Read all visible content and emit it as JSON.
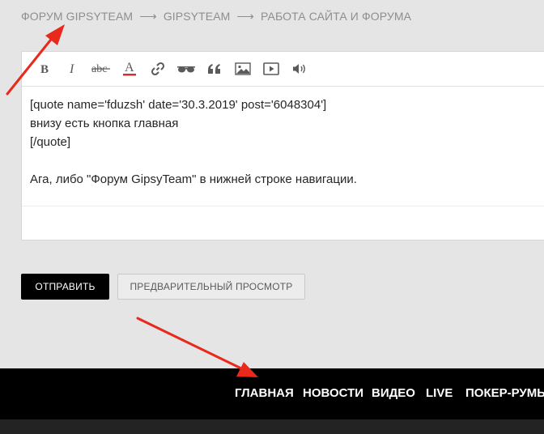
{
  "breadcrumb": {
    "items": [
      "ФОРУМ GIPSYTEAM",
      "GIPSYTEAM",
      "РАБОТА САЙТА И ФОРУМА"
    ],
    "separator": "⟶"
  },
  "toolbar": {
    "buttons": [
      "bold-icon",
      "italic-icon",
      "strikethrough-icon",
      "text-color-icon",
      "link-icon",
      "glasses-icon",
      "quote-icon",
      "image-icon",
      "video-icon",
      "audio-icon"
    ],
    "text_color_accent": "#d32f2f"
  },
  "editor": {
    "lines": [
      "[quote name='fduzsh' date='30.3.2019' post='6048304']",
      "внизу есть кнопка главная",
      "[/quote]",
      "",
      "Ага, либо \"Форум GipsyTeam\" в нижней строке навигации."
    ]
  },
  "actions": {
    "send_label": "ОТПРАВИТЬ",
    "preview_label": "ПРЕДВАРИТЕЛЬНЫЙ ПРОСМОТР"
  },
  "footer_nav": {
    "items": [
      "ГЛАВНАЯ",
      "НОВОСТИ",
      "ВИДЕО",
      "LIVE",
      "ПОКЕР-РУМЫ"
    ]
  },
  "annotation_color": "#e8291c"
}
